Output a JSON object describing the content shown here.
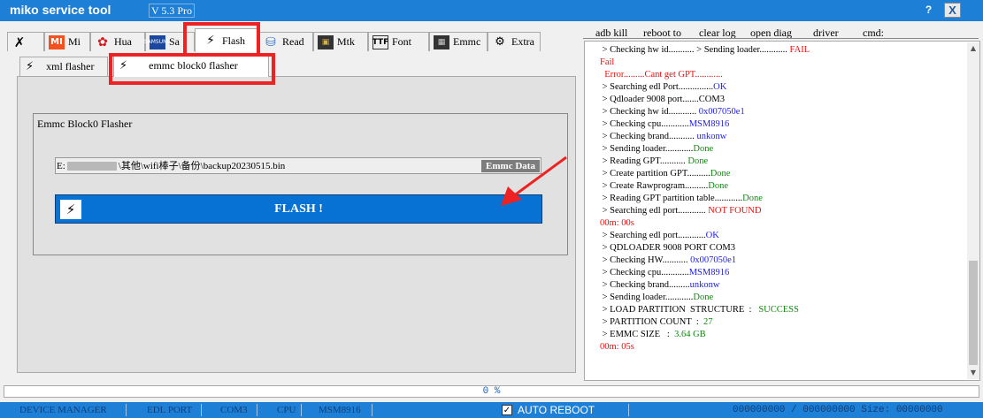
{
  "app": {
    "title": "miko service tool",
    "version": "V 5.3 Pro",
    "help_label": "?",
    "close_label": "X"
  },
  "tabs": [
    {
      "label": "",
      "icon": "tools-icon"
    },
    {
      "label": "Mi",
      "icon": "xiaomi-icon",
      "icon_text": "MI"
    },
    {
      "label": "Hua",
      "icon": "huawei-icon"
    },
    {
      "label": "Sa",
      "icon": "samsung-icon",
      "icon_text": "SAMSUNG"
    },
    {
      "label": "Flash",
      "icon": "flash-icon"
    },
    {
      "label": "Read",
      "icon": "database-icon"
    },
    {
      "label": "Mtk",
      "icon": "chip-icon"
    },
    {
      "label": "Font",
      "icon": "font-file-icon",
      "icon_text": "TTF"
    },
    {
      "label": "Emmc",
      "icon": "emmc-chip-icon"
    },
    {
      "label": "Extra",
      "icon": "settings-gear-icon"
    }
  ],
  "subtabs": [
    {
      "label": "xml flasher",
      "icon": "flash-icon"
    },
    {
      "label": "emmc block0 flasher",
      "icon": "flash-icon"
    }
  ],
  "panel": {
    "group_title": "Emmc Block0 Flasher",
    "path_prefix": "E:",
    "path_suffix": "\\其他\\wifi棒子\\备份\\backup20230515.bin",
    "emmc_data_button": "Emmc Data",
    "flash_button": "FLASH !"
  },
  "menu": [
    "adb kill",
    "reboot to",
    "clear log",
    "open diag",
    "driver",
    "cmd:"
  ],
  "log": [
    [
      {
        "t": " > Checking hw id........... > Sending loader............ "
      },
      {
        "t": "FAIL",
        "c": "red"
      }
    ],
    [
      {
        "t": "Fail",
        "c": "red"
      }
    ],
    [
      {
        "t": "  Error.........Cant get GPT............",
        "c": "red"
      }
    ],
    [
      {
        "t": " > Searching edl Port..............."
      },
      {
        "t": "OK",
        "c": "blue"
      }
    ],
    [
      {
        "t": " > Qdloader 9008 port.......COM3"
      }
    ],
    [
      {
        "t": " > Checking hw id............ "
      },
      {
        "t": "0x007050e1",
        "c": "blue"
      }
    ],
    [
      {
        "t": " > Checking cpu............"
      },
      {
        "t": "MSM8916",
        "c": "blue"
      }
    ],
    [
      {
        "t": " > Checking brand........... "
      },
      {
        "t": "unkonw",
        "c": "blue"
      }
    ],
    [
      {
        "t": " > Sending loader............"
      },
      {
        "t": "Done",
        "c": "green"
      }
    ],
    [
      {
        "t": " > Reading GPT........... "
      },
      {
        "t": "Done",
        "c": "green"
      }
    ],
    [
      {
        "t": " > Create partition GPT.........."
      },
      {
        "t": "Done",
        "c": "green"
      }
    ],
    [
      {
        "t": " > Create Rawprogram.........."
      },
      {
        "t": "Done",
        "c": "green"
      }
    ],
    [
      {
        "t": " > Reading GPT partition table............"
      },
      {
        "t": "Done",
        "c": "green"
      }
    ],
    [
      {
        "t": " > Searching edl port............ "
      },
      {
        "t": "NOT FOUND",
        "c": "red"
      }
    ],
    [
      {
        "t": "00m: 00s",
        "c": "red"
      }
    ],
    [
      {
        "t": " > Searching edl port............"
      },
      {
        "t": "OK",
        "c": "blue"
      }
    ],
    [
      {
        "t": " > QDLOADER 9008 PORT COM3"
      }
    ],
    [
      {
        "t": " > Checking HW........... "
      },
      {
        "t": "0x007050e1",
        "c": "blue"
      }
    ],
    [
      {
        "t": " > Checking cpu............"
      },
      {
        "t": "MSM8916",
        "c": "blue"
      }
    ],
    [
      {
        "t": " > Checking brand........."
      },
      {
        "t": "unkonw",
        "c": "blue"
      }
    ],
    [
      {
        "t": " > Sending loader............"
      },
      {
        "t": "Done",
        "c": "green"
      }
    ],
    [
      {
        "t": " > LOAD PARTITION  STRUCTURE  :   "
      },
      {
        "t": "SUCCESS",
        "c": "green"
      }
    ],
    [
      {
        "t": " > PARTITION COUNT  :  "
      },
      {
        "t": "27",
        "c": "green"
      }
    ],
    [
      {
        "t": " > EMMC SIZE   :  "
      },
      {
        "t": "3.64 GB",
        "c": "green"
      }
    ],
    [
      {
        "t": "00m: 05s",
        "c": "red"
      }
    ]
  ],
  "progress": {
    "text": "0  %",
    "value_percent": 0
  },
  "status": {
    "device_manager": "DEVICE MANAGER",
    "edl_port_label": "EDL PORT",
    "edl_port_value": "COM3",
    "cpu_label": "CPU",
    "cpu_value": "MSM8916",
    "auto_reboot": "AUTO REBOOT",
    "auto_reboot_checked": true,
    "size_info": "000000000 / 000000000 Size: 00000000"
  },
  "colors": {
    "titlebar": "#1e7fd6",
    "flash_button": "#0872d4",
    "highlight": "#ee2222",
    "log_red": "#e81010",
    "log_blue": "#1e1ee8",
    "log_green": "#118811"
  }
}
